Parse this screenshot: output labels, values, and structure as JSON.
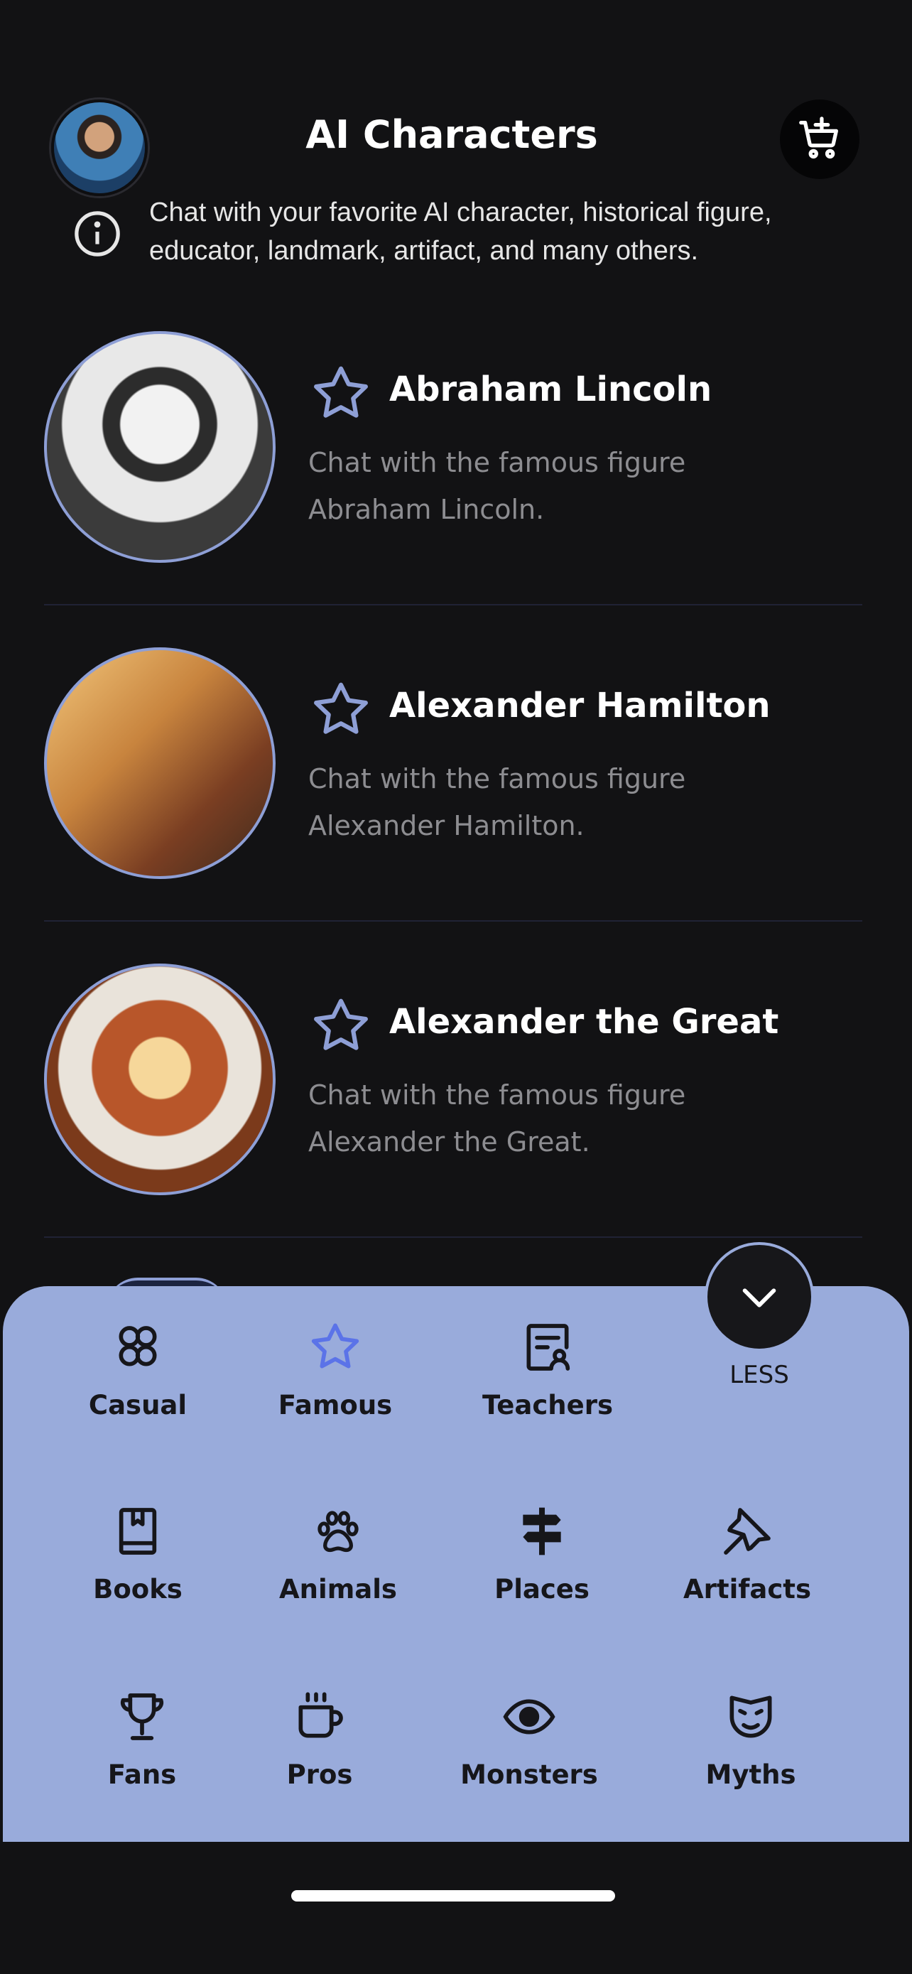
{
  "header": {
    "title": "AI Characters",
    "info_text": "Chat with your favorite AI character, historical figure, educator, landmark, artifact, and many others."
  },
  "characters": [
    {
      "name": "Abraham Lincoln",
      "description": "Chat with the famous figure Abraham Lincoln."
    },
    {
      "name": "Alexander Hamilton",
      "description": "Chat with the famous figure Alexander Hamilton."
    },
    {
      "name": "Alexander the Great",
      "description": "Chat with the famous figure Alexander the Great."
    }
  ],
  "categories": {
    "less_label": "LESS",
    "items": [
      {
        "label": "Casual",
        "icon": "users-group-icon"
      },
      {
        "label": "Famous",
        "icon": "star-icon",
        "active": true
      },
      {
        "label": "Teachers",
        "icon": "teacher-icon"
      },
      {
        "label": "Books",
        "icon": "book-icon"
      },
      {
        "label": "Animals",
        "icon": "paw-icon"
      },
      {
        "label": "Places",
        "icon": "signpost-icon"
      },
      {
        "label": "Artifacts",
        "icon": "pin-icon"
      },
      {
        "label": "Fans",
        "icon": "trophy-icon"
      },
      {
        "label": "Pros",
        "icon": "coffee-icon"
      },
      {
        "label": "Monsters",
        "icon": "eye-icon"
      },
      {
        "label": "Myths",
        "icon": "mask-icon"
      }
    ]
  },
  "colors": {
    "background": "#121214",
    "sheet": "#99abdb",
    "accent": "#8e9fd6",
    "star_active": "#5b73e8"
  }
}
